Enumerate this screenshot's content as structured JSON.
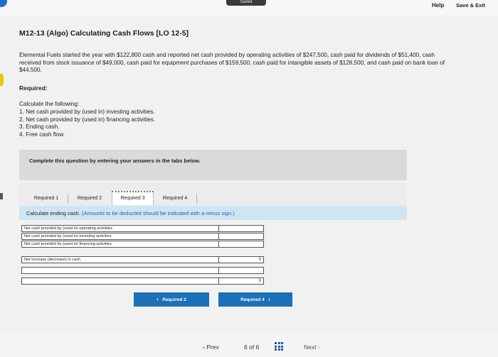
{
  "header": {
    "saved_label": "Saved",
    "help_label": "Help",
    "save_exit_label": "Save & Exit"
  },
  "problem": {
    "title": "M12-13 (Algo) Calculating Cash Flows [LO 12-5]",
    "paragraph": "Elemental Fuels started the year with $122,800 cash and reported net cash provided by operating activities of $247,500, cash paid for dividends of $51,400, cash received from stock issuance of $49,000, cash paid for equipment purchases of $159,500, cash paid for intangible assets of $128,500, and cash paid on bank loan of $44,500.",
    "required_label": "Required:",
    "calculate_intro": "Calculate the following:",
    "items": [
      "1. Net cash provided by (used in) investing activities.",
      "2. Net cash provided by (used in) financing activities.",
      "3. Ending cash.",
      "4. Free cash flow."
    ]
  },
  "instruction": "Complete this question by entering your answers in the tabs below.",
  "tabs": [
    {
      "label": "Required 1"
    },
    {
      "label": "Required 2"
    },
    {
      "label": "Required 3"
    },
    {
      "label": "Required 4"
    }
  ],
  "hint": {
    "main": "Calculate ending cash.",
    "note": "(Amounts to be deducted should be indicated with a minus sign.)"
  },
  "table": {
    "rows": [
      {
        "label": "Net cash provided by (used in) operating activities",
        "value": ""
      },
      {
        "label": "Net cash provided by (used in) investing activities",
        "value": ""
      },
      {
        "label": "Net cash provided by (used in) financing activities",
        "value": ""
      },
      {
        "label": "Net increase (decrease) in cash",
        "value": "0"
      },
      {
        "label": "",
        "value": ""
      },
      {
        "label": "",
        "value": "0"
      }
    ]
  },
  "nav_buttons": {
    "prev_label": "Required 2",
    "next_label": "Required 4"
  },
  "footer": {
    "prev_label": "Prev",
    "page_current": "6",
    "page_of": "of",
    "page_total": "6",
    "next_label": "Next"
  }
}
